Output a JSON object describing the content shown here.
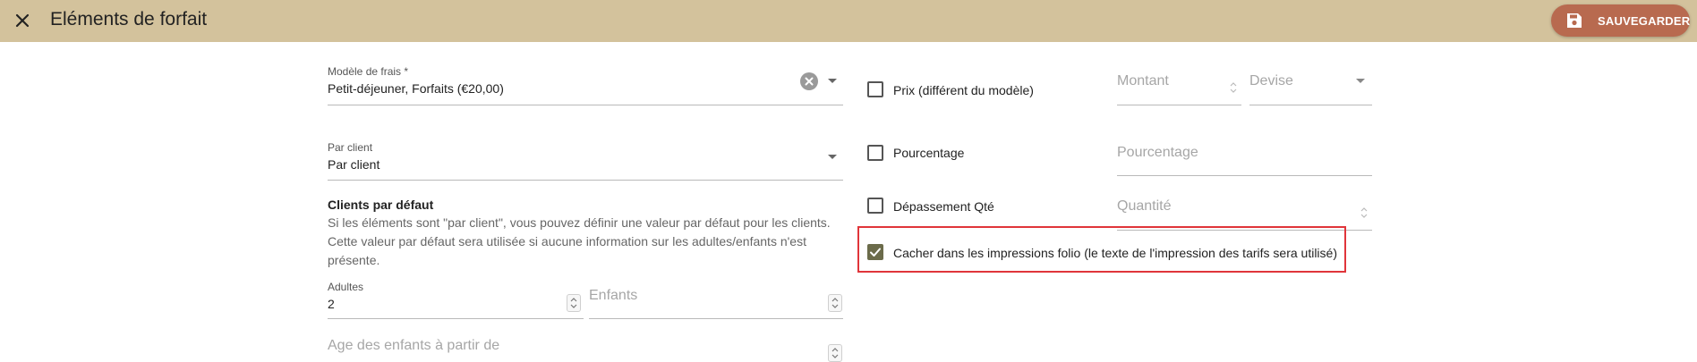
{
  "header": {
    "title": "Eléments de forfait",
    "save_label": "SAUVEGARDER"
  },
  "form": {
    "model_fee": {
      "label": "Modèle de frais *",
      "value": "Petit-déjeuner, Forfaits (€20,00)"
    },
    "per_client": {
      "label": "Par client",
      "value": "Par client"
    },
    "default_clients": {
      "title": "Clients par défaut",
      "description": "Si les éléments sont \"par client\", vous pouvez définir une valeur par défaut pour les clients. Cette valeur par défaut sera utilisée si aucune information sur les adultes/enfants n'est présente."
    },
    "adults": {
      "label": "Adultes",
      "value": "2"
    },
    "children": {
      "placeholder": "Enfants"
    },
    "child_age": {
      "placeholder": "Age des enfants à partir de"
    },
    "price": {
      "label": "Prix (différent du modèle)",
      "checked": false,
      "amount_placeholder": "Montant",
      "currency_placeholder": "Devise"
    },
    "percentage": {
      "label": "Pourcentage",
      "checked": false,
      "placeholder": "Pourcentage"
    },
    "overflow_qty": {
      "label": "Dépassement Qté",
      "checked": false,
      "placeholder": "Quantité"
    },
    "hide_folio": {
      "label": "Cacher dans les impressions folio (le texte de l'impression des tarifs sera utilisé)",
      "checked": true
    }
  },
  "icons": {
    "close": "close-icon",
    "save": "floppy-disk-icon",
    "clear": "clear-circle-icon",
    "dropdown": "chevron-down-icon",
    "stepper": "stepper-arrows-icon",
    "check": "check-icon"
  },
  "colors": {
    "header_bg": "#d3c29c",
    "save_button": "#b86a4f",
    "checkbox_checked": "#6b6b4a",
    "highlight_box": "#e0353a"
  }
}
